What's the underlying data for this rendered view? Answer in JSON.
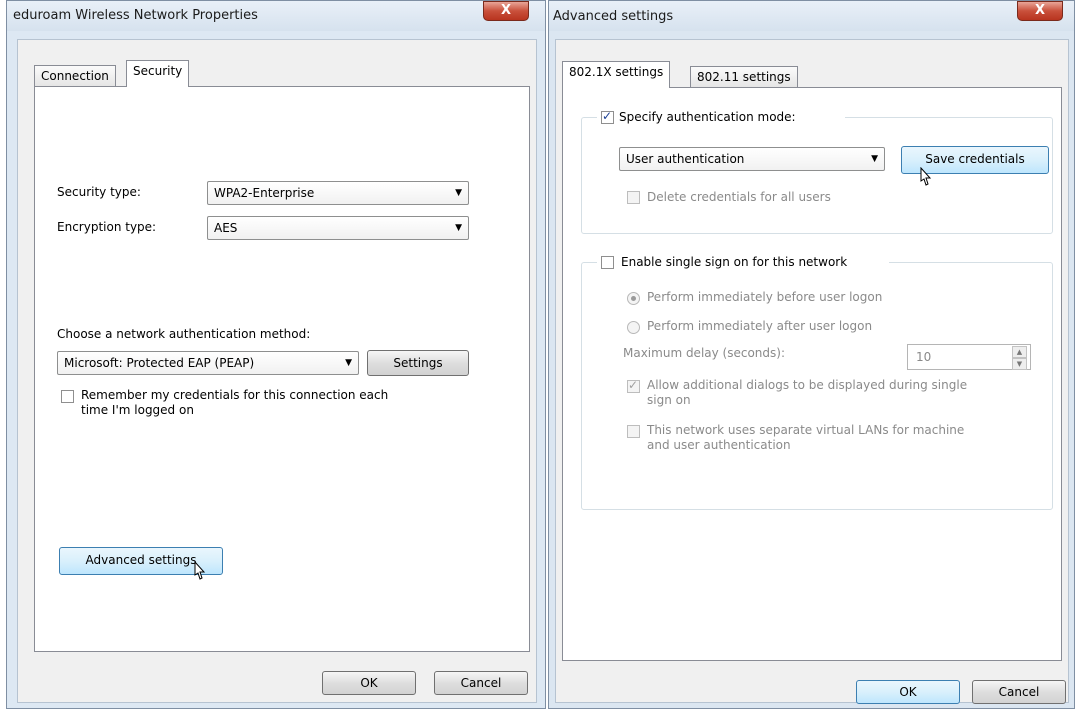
{
  "left_window": {
    "title": "eduroam Wireless Network Properties",
    "close_label": "X",
    "tabs": [
      {
        "label": "Connection"
      },
      {
        "label": "Security"
      }
    ],
    "security_type_label": "Security type:",
    "security_type_value": "WPA2-Enterprise",
    "encryption_type_label": "Encryption type:",
    "encryption_type_value": "AES",
    "auth_method_label": "Choose a network authentication method:",
    "auth_method_value": "Microsoft: Protected EAP (PEAP)",
    "settings_button": "Settings",
    "remember_line1": "Remember my credentials for this connection each",
    "remember_line2": "time I'm logged on",
    "advanced_button": "Advanced settings",
    "ok_button": "OK",
    "cancel_button": "Cancel"
  },
  "right_window": {
    "title": "Advanced settings",
    "close_label": "X",
    "tabs": [
      {
        "label": "802.1X settings"
      },
      {
        "label": "802.11 settings"
      }
    ],
    "specify_auth_label": "Specify authentication mode:",
    "auth_mode_value": "User authentication",
    "save_credentials_button": "Save credentials",
    "delete_credentials_label": "Delete credentials for all users",
    "sso_label": "Enable single sign on for this network",
    "perform_before_label": "Perform immediately before user logon",
    "perform_after_label": "Perform immediately after user logon",
    "max_delay_label": "Maximum delay (seconds):",
    "max_delay_value": "10",
    "allow_dialogs_line1": "Allow additional dialogs to be displayed during single",
    "allow_dialogs_line2": "sign on",
    "vlan_line1": "This network uses separate virtual LANs for machine",
    "vlan_line2": "and user authentication",
    "ok_button": "OK",
    "cancel_button": "Cancel"
  },
  "states": {
    "remember_checked": false,
    "specify_auth_checked": true,
    "delete_credentials_checked": false,
    "sso_checked": false,
    "perform_before_selected": true,
    "allow_dialogs_checked": true,
    "vlan_checked": false
  },
  "icons": [
    "close-icon",
    "dropdown-arrow-icon",
    "spin-up-icon",
    "spin-down-icon",
    "mouse-cursor-icon"
  ],
  "colors": {
    "close_button": "#c9503b",
    "hot_button": "#bee6fd",
    "window_frame": "#dde8f3"
  }
}
